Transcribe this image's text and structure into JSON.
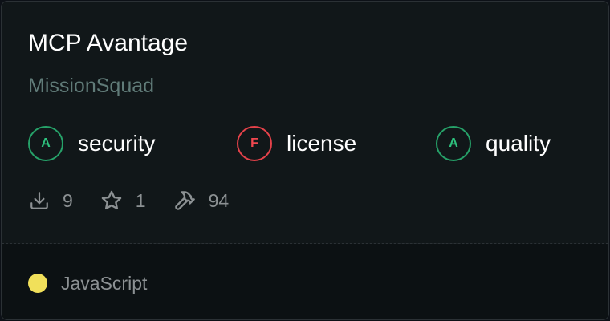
{
  "card": {
    "title": "MCP Avantage",
    "author": "MissionSquad"
  },
  "grades": [
    {
      "grade": "A",
      "label": "security",
      "status": "good",
      "color": "#2ec27e"
    },
    {
      "grade": "F",
      "label": "license",
      "status": "bad",
      "color": "#f0474f"
    },
    {
      "grade": "A",
      "label": "quality",
      "status": "good",
      "color": "#2ec27e"
    }
  ],
  "stats": {
    "downloads": {
      "icon": "download-icon",
      "value": "9"
    },
    "stars": {
      "icon": "star-icon",
      "value": "1"
    },
    "tools": {
      "icon": "hammer-icon",
      "value": "94"
    }
  },
  "footer": {
    "language": "JavaScript",
    "language_color": "#f1e05a"
  }
}
